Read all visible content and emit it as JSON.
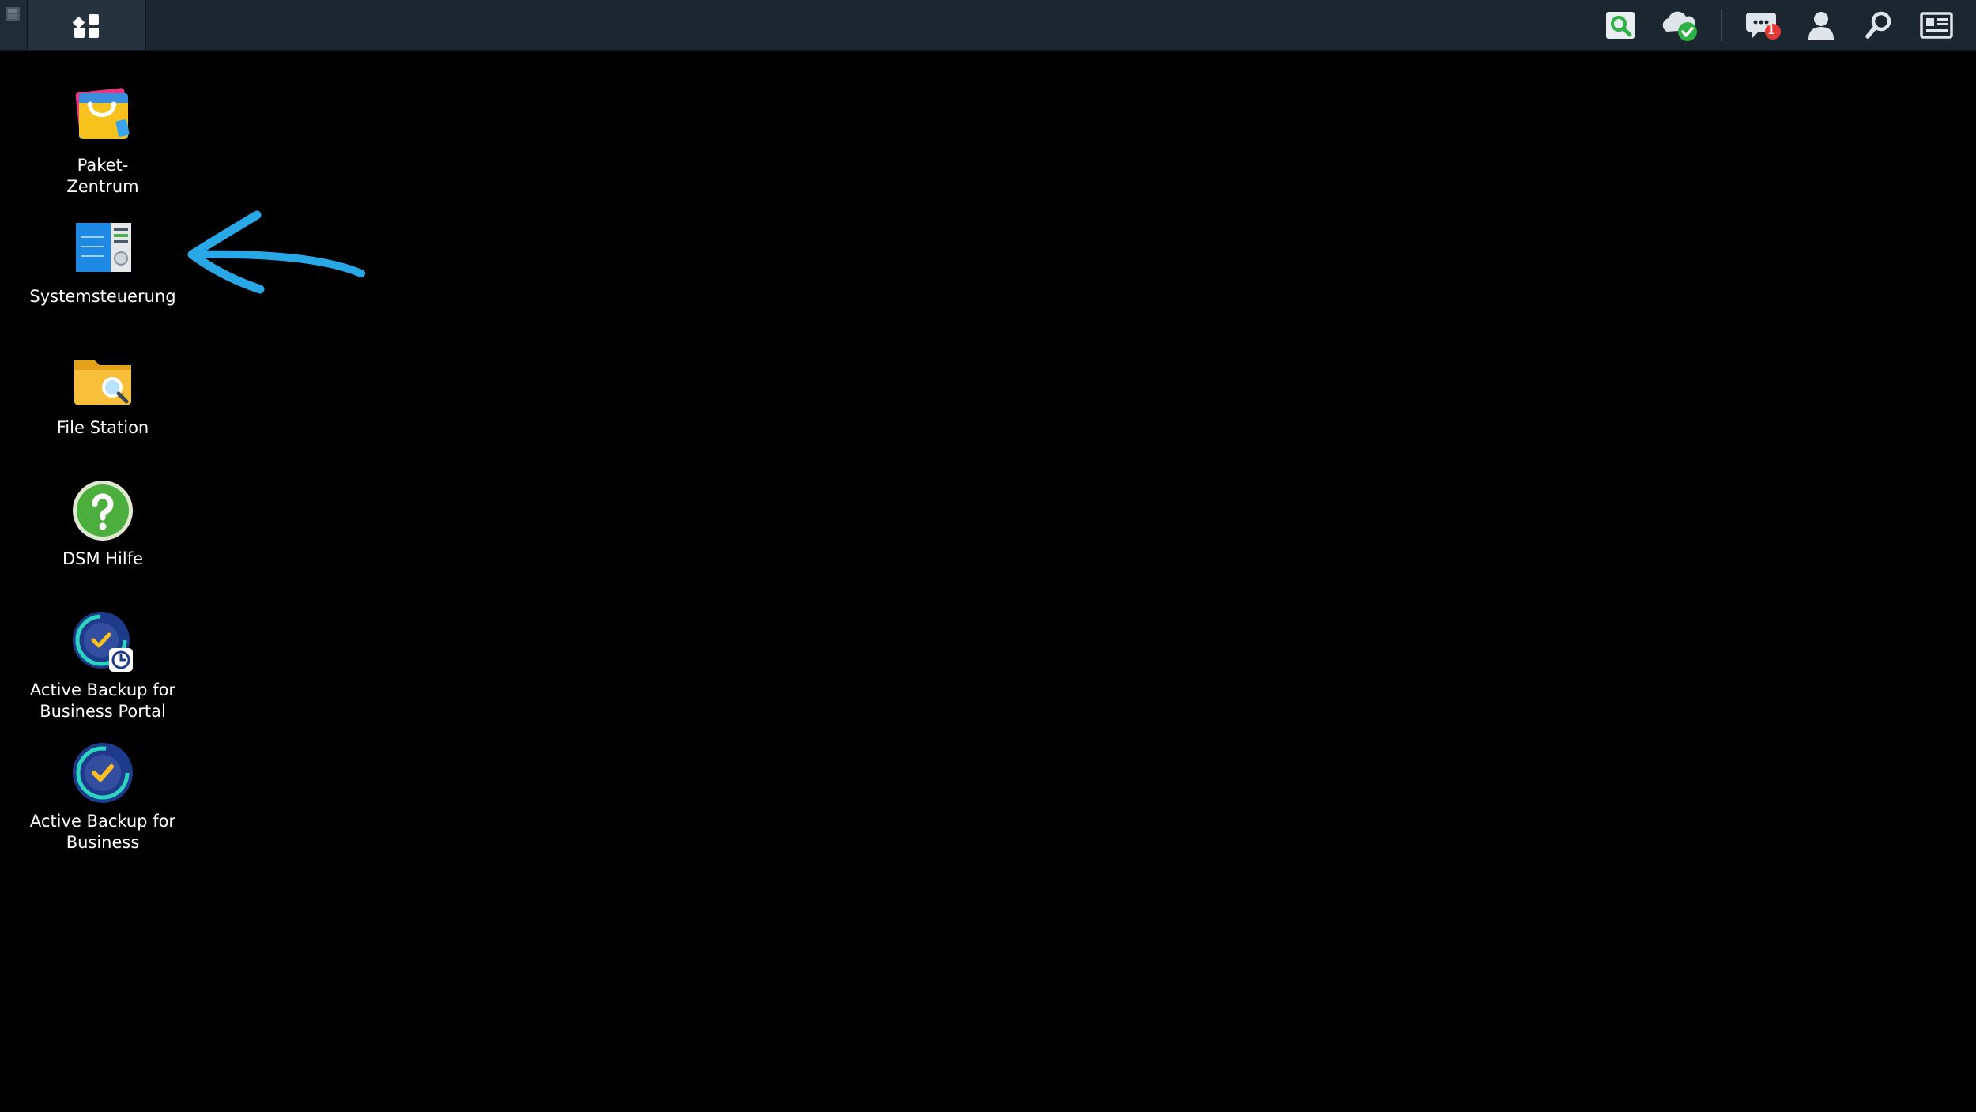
{
  "taskbar": {
    "corner_icon": "window-thumbnail-icon",
    "main_menu_icon": "main-menu-grid-icon",
    "tray": [
      {
        "name": "resource-monitor-icon"
      },
      {
        "name": "cloud-sync-status-icon"
      },
      {
        "name": "notifications-icon",
        "badge": "1"
      },
      {
        "name": "user-icon"
      },
      {
        "name": "search-icon"
      },
      {
        "name": "widgets-icon"
      }
    ]
  },
  "desktop": {
    "items": [
      {
        "label": "Paket-\nZentrum",
        "icon": "package-center-icon"
      },
      {
        "label": "Systemsteuerung",
        "icon": "control-panel-icon"
      },
      {
        "label": "File Station",
        "icon": "file-station-icon"
      },
      {
        "label": "DSM Hilfe",
        "icon": "dsm-help-icon"
      },
      {
        "label": "Active Backup for\nBusiness Portal",
        "icon": "active-backup-portal-icon"
      },
      {
        "label": "Active Backup for\nBusiness",
        "icon": "active-backup-icon"
      }
    ]
  },
  "annotation": {
    "icon": "hand-drawn-arrow-icon",
    "color": "#29a8e8"
  },
  "colors": {
    "taskbar_bg": "#1b2631",
    "desktop_bg": "#000000",
    "badge": "#e53935",
    "cloud_ok": "#2fb344"
  }
}
